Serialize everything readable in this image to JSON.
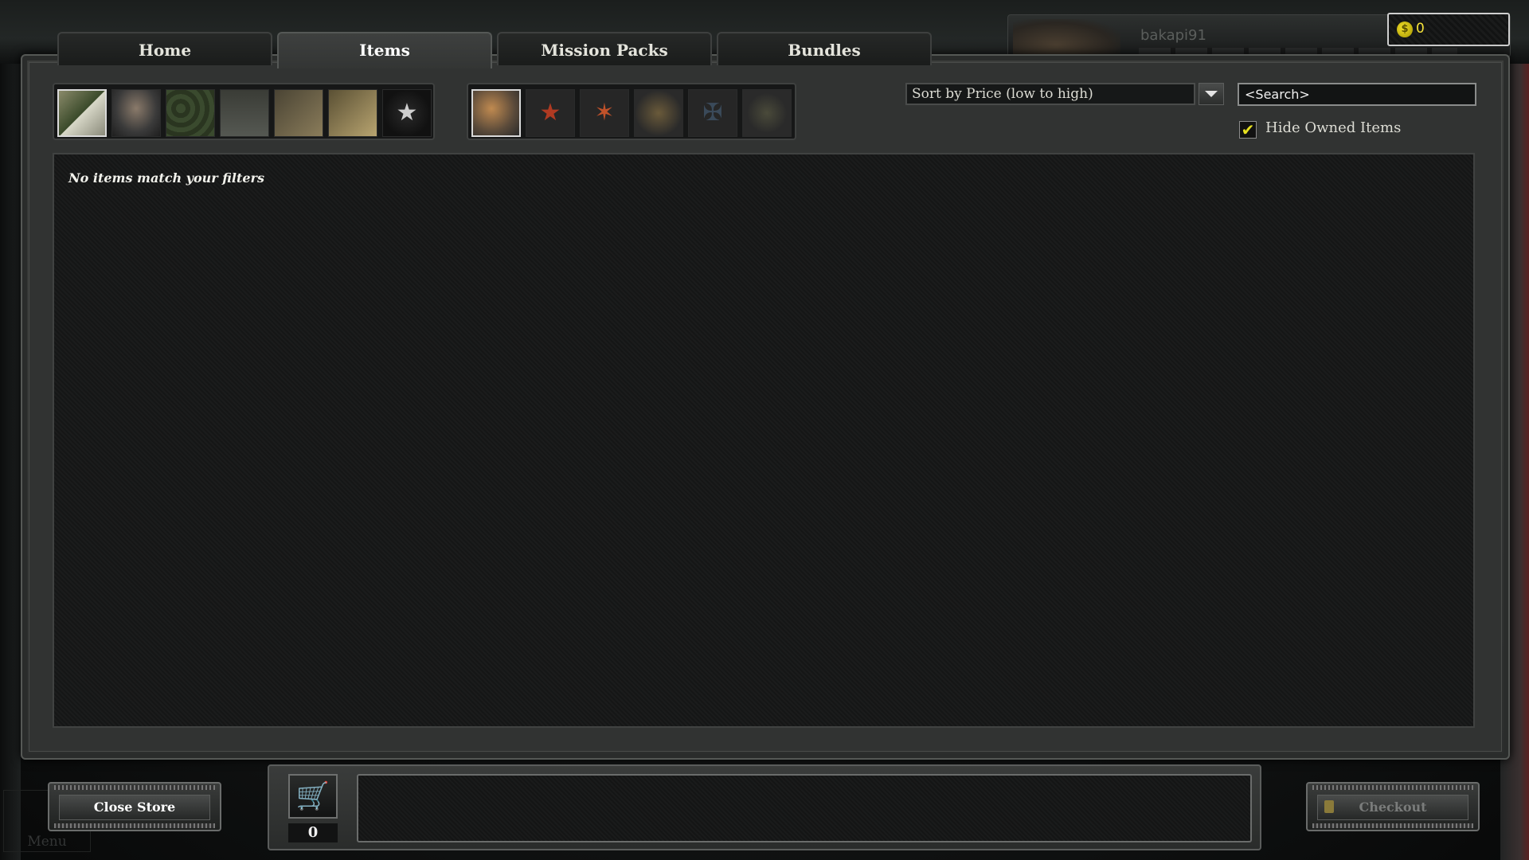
{
  "tabs": [
    {
      "label": "Home"
    },
    {
      "label": "Items"
    },
    {
      "label": "Mission Packs"
    },
    {
      "label": "Bundles"
    }
  ],
  "active_tab": "Items",
  "profile": {
    "username": "bakapi91",
    "currency_icon": "coin-icon",
    "currency_symbol": "$",
    "currency_value": "0",
    "currency_color": "#f5e23a"
  },
  "filters": {
    "category_icons": [
      "all-items-icon",
      "commander-portrait-icon",
      "camouflage-icon",
      "uniform-icon",
      "weapon-upgrade-icon",
      "ammo-icon",
      "army-star-icon"
    ],
    "faction_icons": [
      "all-factions-icon",
      "soviet-star-icon",
      "red-star-alt-icon",
      "shield-emblem-icon",
      "iron-cross-icon",
      "medal-icon"
    ],
    "sort": {
      "selected": "Sort by Price (low to high)"
    },
    "search": {
      "placeholder": "<Search>"
    },
    "hide_owned": {
      "label": "Hide Owned Items",
      "checked": true,
      "check_glyph": "✔"
    }
  },
  "items": {
    "empty_message": "No items match your filters"
  },
  "bottom": {
    "close_store_label": "Close Store",
    "checkout_label": "Checkout",
    "menu_label": "Menu",
    "cart_icon": "cart-icon",
    "cart_glyph": "🛒",
    "cart_count": "0"
  }
}
